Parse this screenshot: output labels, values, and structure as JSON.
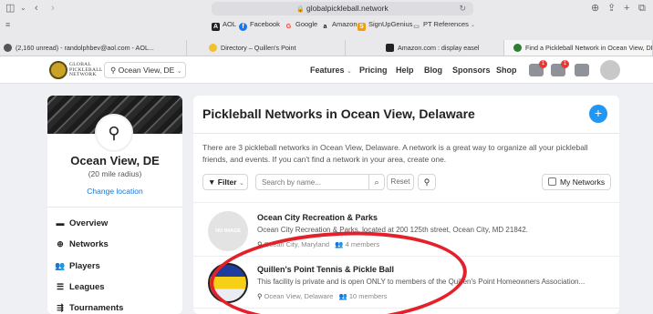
{
  "browser": {
    "url": "globalpickleball.network",
    "favorites": [
      {
        "label": "AOL",
        "color": "#222222",
        "glyph": "A"
      },
      {
        "label": "Facebook",
        "color": "#1877f2",
        "glyph": "f"
      },
      {
        "label": "Google",
        "color": "#ea4335",
        "glyph": "G"
      },
      {
        "label": "Amazon",
        "color": "#111111",
        "glyph": "a"
      },
      {
        "label": "SignUpGenius",
        "color": "#f39c12",
        "glyph": "S"
      },
      {
        "label": "PT References",
        "color": "#888888",
        "glyph": "▭"
      }
    ],
    "tabs": [
      {
        "label": "(2,160 unread) - randolphbev@aol.com - AOL...",
        "color": "#555555",
        "active": false
      },
      {
        "label": "Directory – Quillen's Point",
        "color": "#f2c12e",
        "active": false
      },
      {
        "label": "Amazon.com : display easel",
        "color": "#222222",
        "active": false
      },
      {
        "label": "Find a Pickleball Network in Ocean View, DE",
        "color": "#2e7d32",
        "active": true
      }
    ]
  },
  "header": {
    "logo_text": [
      "GLOBAL",
      "PICKLEBALL",
      "NETWORK"
    ],
    "location": "Ocean View, DE",
    "nav": {
      "features": "Features",
      "pricing": "Pricing",
      "help": "Help",
      "blog": "Blog",
      "sponsors": "Sponsors",
      "shop": "Shop"
    },
    "badges": {
      "messages": "1",
      "notifications": "1"
    }
  },
  "sidebar": {
    "city": "Ocean View, DE",
    "radius": "(20 mile radius)",
    "change_location": "Change location",
    "items": [
      {
        "label": "Overview",
        "icon": "▬",
        "name": "overview"
      },
      {
        "label": "Networks",
        "icon": "⊕",
        "name": "networks"
      },
      {
        "label": "Players",
        "icon": "👥",
        "name": "players"
      },
      {
        "label": "Leagues",
        "icon": "☰",
        "name": "leagues"
      },
      {
        "label": "Tournaments",
        "icon": "⇶",
        "name": "tournaments"
      }
    ]
  },
  "main": {
    "title": "Pickleball Networks in Ocean View, Delaware",
    "intro": "There are 3 pickleball networks in Ocean View, Delaware. A network is a great way to organize all your pickleball friends, and events. If you can't find a network in your area, create one.",
    "filter_label": "Filter",
    "search_placeholder": "Search by name...",
    "reset_label": "Reset",
    "my_networks_label": "My Networks",
    "networks": [
      {
        "thumb_text": "NO IMAGE",
        "name": "Ocean City Recreation & Parks",
        "desc": "Ocean City Recreation & Parks, located at 200 125th street, Ocean City, MD 21842.",
        "location": "Ocean City, Maryland",
        "members": "4 members"
      },
      {
        "thumb_text": "",
        "name": "Quillen's Point Tennis & Pickle Ball",
        "desc": "This facility is private and is open ONLY to members of the Quillen's Point Homeowners Association...",
        "location": "Ocean View, Delaware",
        "members": "10 members"
      }
    ]
  },
  "colors": {
    "accent_blue": "#2196f3",
    "link_blue": "#1976d2",
    "badge_red": "#e53935",
    "annotation_red": "#e4202a"
  }
}
